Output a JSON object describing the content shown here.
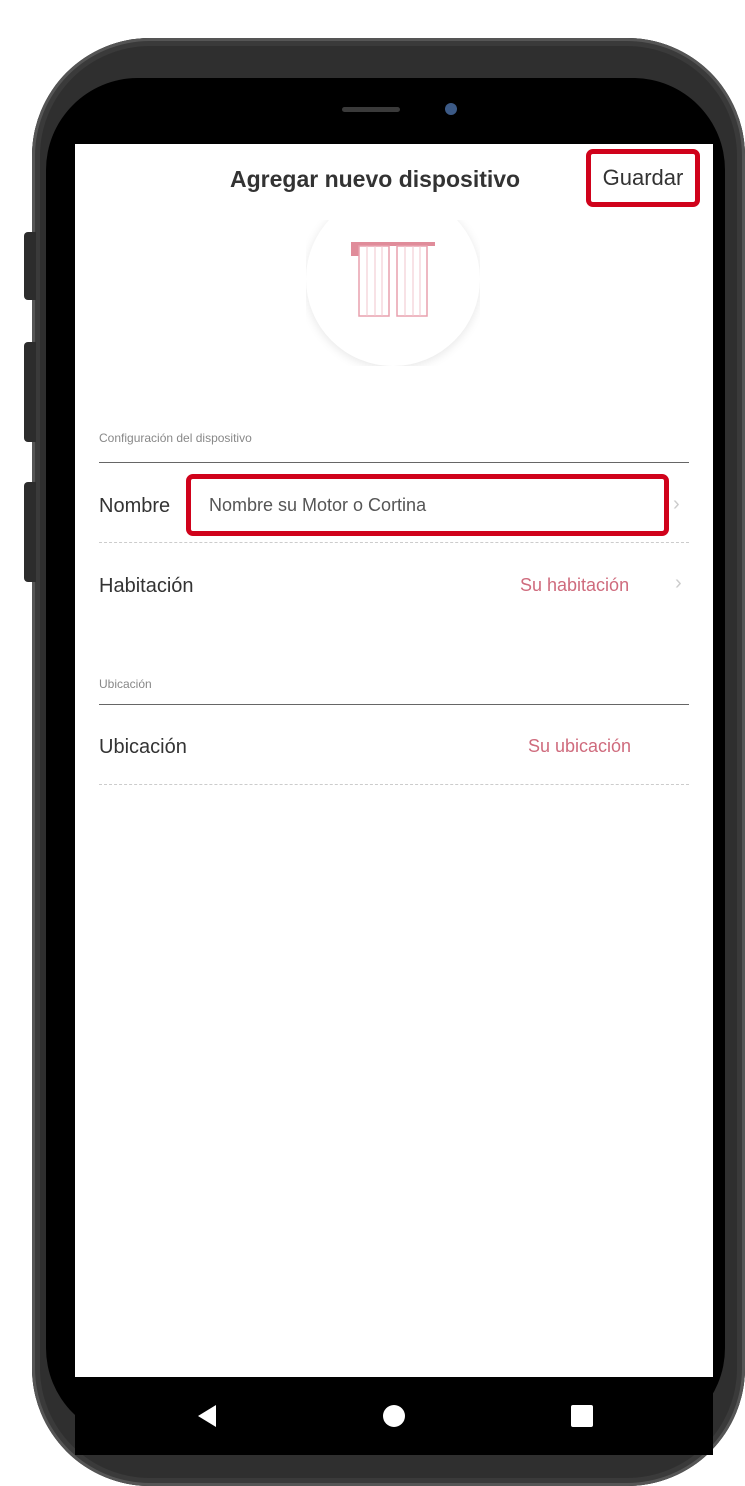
{
  "header": {
    "title": "Agregar nuevo dispositivo",
    "save_label": "Guardar"
  },
  "device_icon": "curtain-icon",
  "sections": {
    "config_label": "Configuración del dispositivo",
    "location_label": "Ubicación"
  },
  "rows": {
    "name": {
      "label": "Nombre",
      "placeholder": "Nombre su Motor o Cortina",
      "value": ""
    },
    "room": {
      "label": "Habitación",
      "value": "Su habitación"
    },
    "location": {
      "label": "Ubicación",
      "value": "Su ubicación"
    }
  },
  "navbar": {
    "back_icon": "back-triangle-icon",
    "home_icon": "home-circle-icon",
    "recent_icon": "recent-square-icon"
  },
  "colors": {
    "accent": "#cf6b7d",
    "highlight": "#d0021b",
    "text": "#333333"
  }
}
